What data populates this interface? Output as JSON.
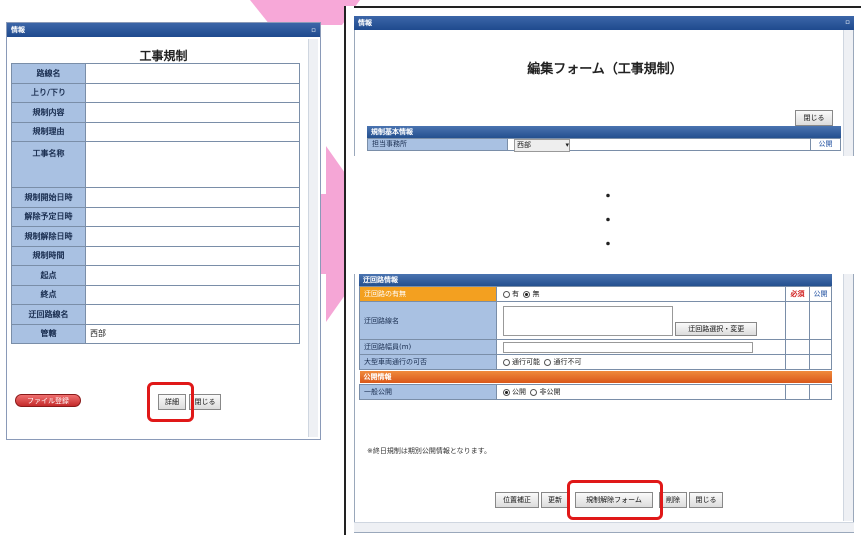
{
  "left_window": {
    "title": "情報",
    "heading": "工事規制",
    "rows": [
      {
        "label": "路線名",
        "value": ""
      },
      {
        "label": "上り/下り",
        "value": ""
      },
      {
        "label": "規制内容",
        "value": ""
      },
      {
        "label": "規制理由",
        "value": ""
      },
      {
        "label": "工事名称",
        "value": ""
      },
      {
        "label": "規制開始日時",
        "value": ""
      },
      {
        "label": "解除予定日時",
        "value": ""
      },
      {
        "label": "規制解除日時",
        "value": ""
      },
      {
        "label": "規制時間",
        "value": ""
      },
      {
        "label": "起点",
        "value": ""
      },
      {
        "label": "終点",
        "value": ""
      },
      {
        "label": "迂回路線名",
        "value": ""
      },
      {
        "label": "管轄",
        "value": "西部"
      }
    ],
    "file_button": "ファイル登録",
    "detail_button": "詳細",
    "close_button": "閉じる"
  },
  "right_window": {
    "title": "情報",
    "heading": "編集フォーム（工事規制）",
    "close_button": "閉じる",
    "basic_section": "規制基本情報",
    "office_label": "担当事務所",
    "office_value": "西部",
    "public_label": "公開",
    "ellipsis": "・",
    "detour_section": "迂回路情報",
    "detour_rows": {
      "has_detour": {
        "label": "迂回路の有無",
        "opt_yes": "有",
        "opt_no": "無",
        "required": "必須",
        "public": "公開"
      },
      "route_name": {
        "label": "迂回路線名",
        "button": "迂回路選択・変更"
      },
      "width": {
        "label": "迂回路幅員(m)"
      },
      "large_vehicle": {
        "label": "大型車両通行の可否",
        "opt_ok": "通行可能",
        "opt_ng": "通行不可"
      }
    },
    "public_section": "公開情報",
    "general_public": {
      "label": "一般公開",
      "opt_public": "公開",
      "opt_private": "非公開"
    },
    "note": "※終日規制は期別公開情報となります。",
    "buttons": {
      "position": "位置補正",
      "update": "更新",
      "release_form": "規制解除フォーム",
      "delete": "削除",
      "close": "閉じる"
    }
  }
}
